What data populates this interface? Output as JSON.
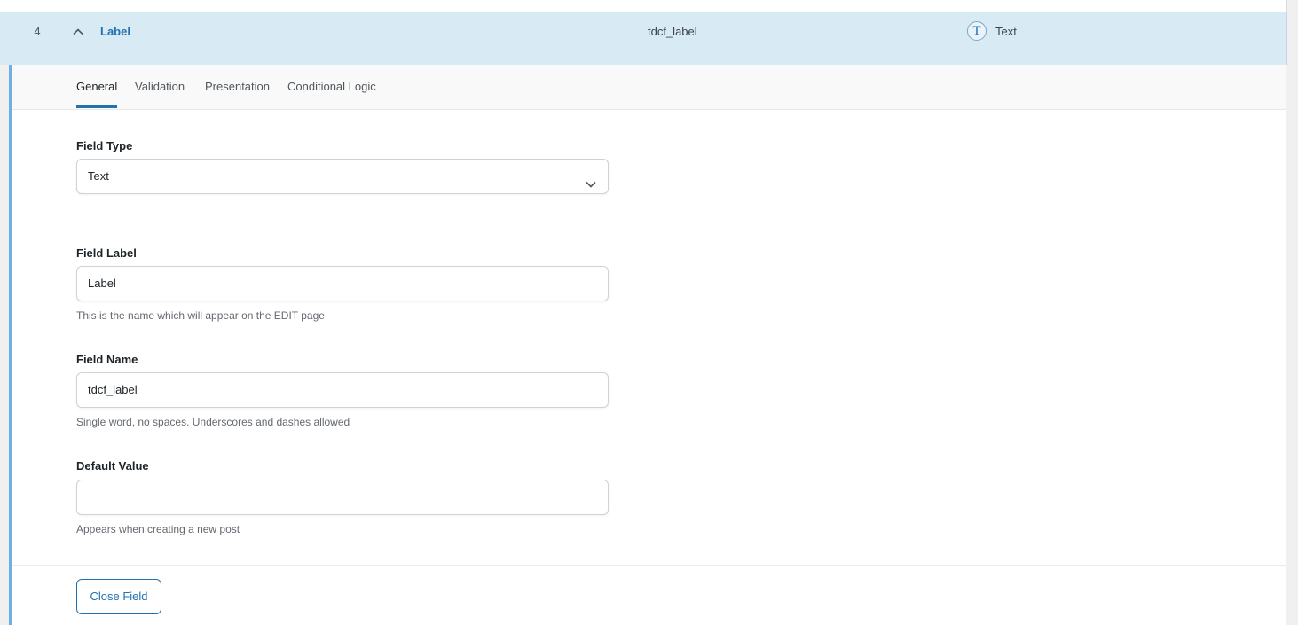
{
  "field_row": {
    "order": "4",
    "label": "Label",
    "name": "tdcf_label",
    "type_icon": "text-type-icon",
    "type": "Text"
  },
  "tabs": [
    {
      "label": "General",
      "active": true
    },
    {
      "label": "Validation",
      "active": false
    },
    {
      "label": "Presentation",
      "active": false
    },
    {
      "label": "Conditional Logic",
      "active": false
    }
  ],
  "general": {
    "field_type": {
      "label": "Field Type",
      "value": "Text"
    },
    "field_label": {
      "label": "Field Label",
      "value": "Label",
      "help": "This is the name which will appear on the EDIT page"
    },
    "field_name": {
      "label": "Field Name",
      "value": "tdcf_label",
      "help": "Single word, no spaces. Underscores and dashes allowed"
    },
    "default_value": {
      "label": "Default Value",
      "value": "",
      "help": "Appears when creating a new post"
    }
  },
  "actions": {
    "close_field": "Close Field"
  },
  "colors": {
    "accent": "#2271b1",
    "row_highlight": "#d8eaf4",
    "left_border": "#72aee6"
  }
}
